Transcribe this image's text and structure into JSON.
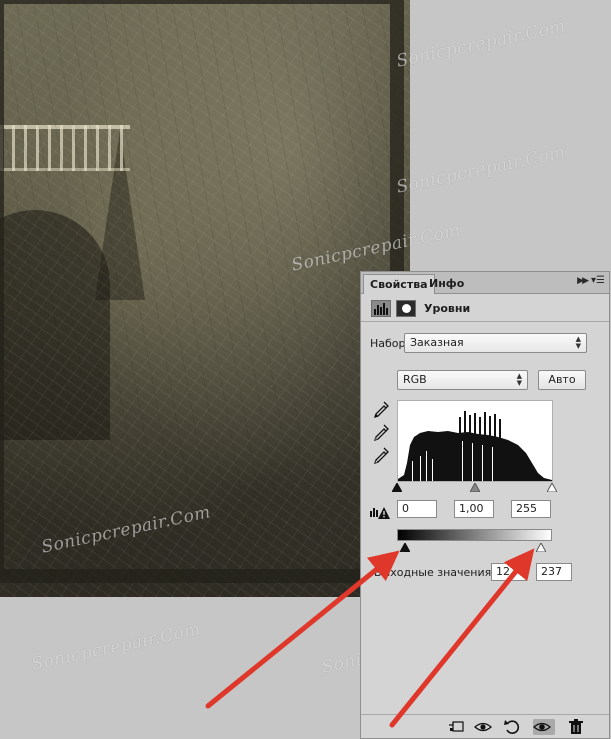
{
  "watermark": {
    "text": "Sonicpcrepair.Com"
  },
  "panel": {
    "tabs": [
      {
        "label": "Свойства"
      },
      {
        "label": "Инфо"
      }
    ],
    "collapse_icon": "double-chevron-right-icon",
    "menu_icon": "panel-menu-icon",
    "adjustment_icon": "levels-adjustment-icon",
    "mask_icon": "layer-mask-icon",
    "title": "Уровни",
    "preset": {
      "label": "Набор:",
      "value": "Заказная"
    },
    "channel": {
      "value": "RGB"
    },
    "auto_button": "Авто",
    "eyedroppers": [
      "black-point-eyedropper-icon",
      "gray-point-eyedropper-icon",
      "white-point-eyedropper-icon"
    ],
    "input_levels": {
      "black": "0",
      "gamma": "1,00",
      "white": "255",
      "black_slider": 0,
      "gamma_slider": 128,
      "white_slider": 255
    },
    "clipping_warning_icon": "levels-clipping-warning-icon",
    "output_levels": {
      "label": "Выходные значения:",
      "black": "12",
      "white": "237",
      "black_slider": 12,
      "white_slider": 237
    },
    "footer_icons": [
      "clip-to-layer-icon",
      "view-previous-state-icon",
      "reset-icon",
      "visibility-eye-icon",
      "delete-trash-icon"
    ]
  },
  "annotation": {
    "arrow_color": "#e0372b"
  }
}
